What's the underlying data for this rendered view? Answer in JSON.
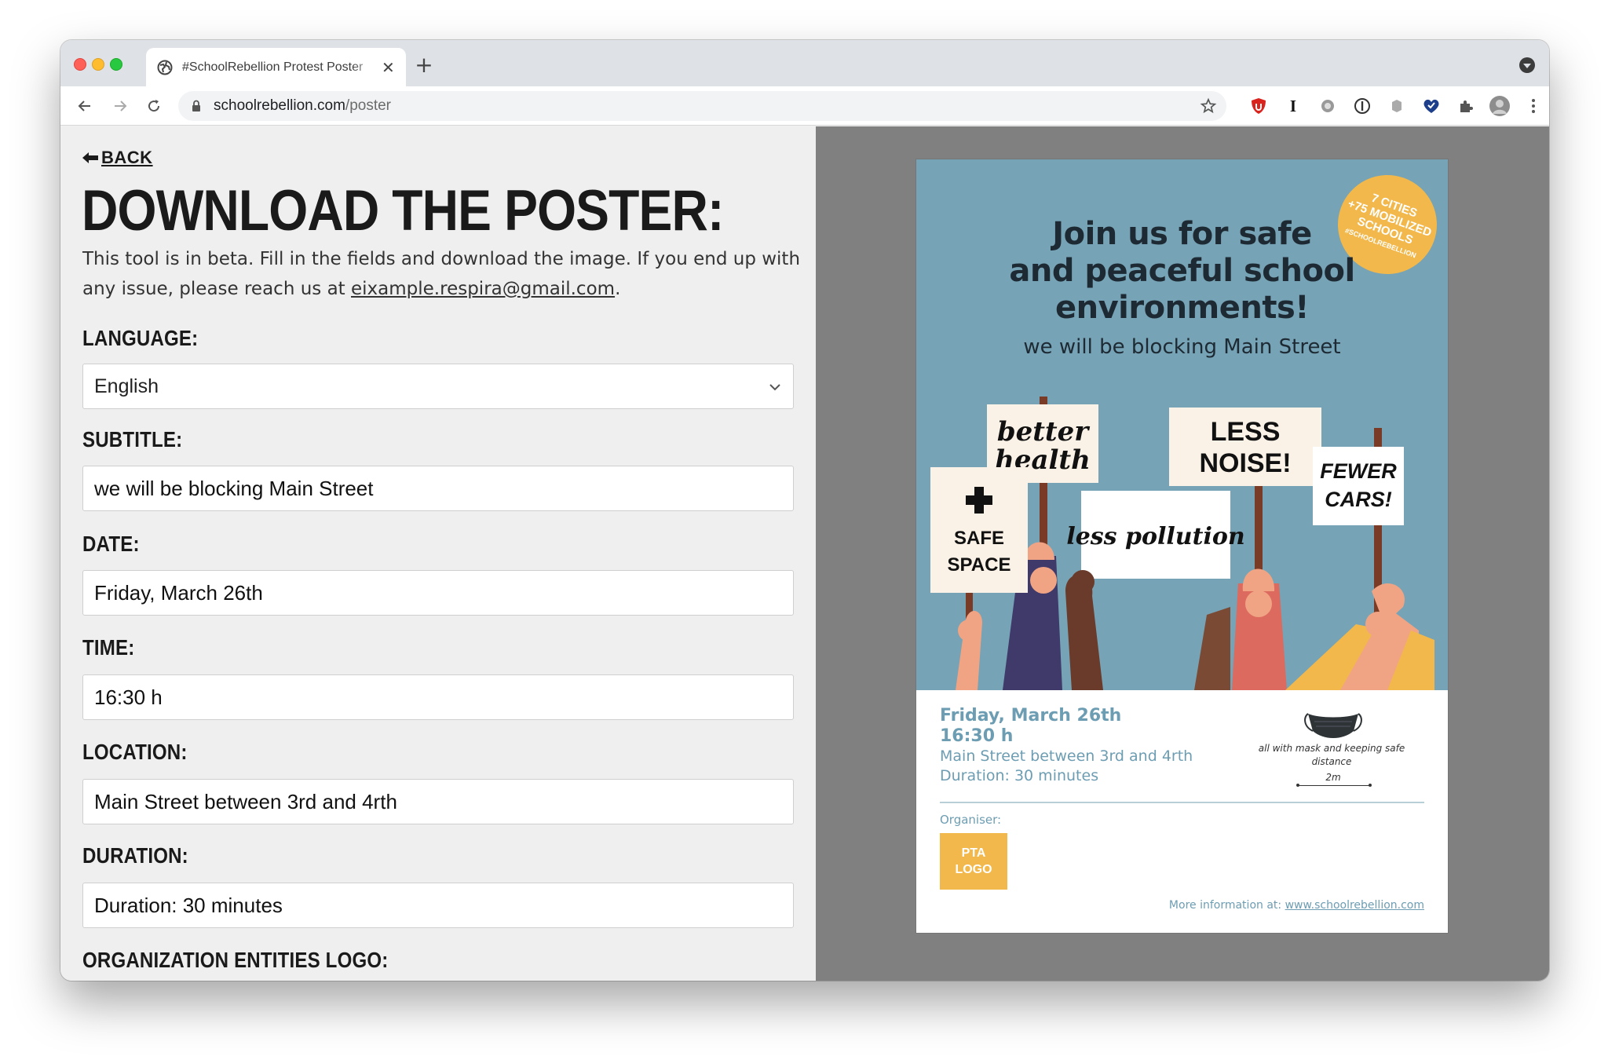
{
  "browser": {
    "tab_title": "#SchoolRebellion Protest Poster",
    "url_domain": "schoolrebellion.com",
    "url_path": "/poster"
  },
  "form": {
    "back_label": "BACK",
    "title": "DOWNLOAD THE POSTER:",
    "intro_text": "This tool is in beta. Fill in the fields and download the image. If you end up with any issue, please reach us at ",
    "intro_email": "eixample.respira@gmail.com",
    "intro_end": ".",
    "language": {
      "label": "LANGUAGE:",
      "value": "English"
    },
    "subtitle": {
      "label": "SUBTITLE:",
      "value": "we will be blocking Main Street"
    },
    "date": {
      "label": "DATE:",
      "value": "Friday, March 26th"
    },
    "time": {
      "label": "TIME:",
      "value": "16:30 h"
    },
    "location": {
      "label": "LOCATION:",
      "value": "Main Street between 3rd and 4rth"
    },
    "duration": {
      "label": "DURATION:",
      "value": "Duration: 30 minutes"
    },
    "logo": {
      "label": "ORGANIZATION ENTITIES LOGO:"
    }
  },
  "poster": {
    "badge_line1": "7 CITIES",
    "badge_line2": "+75 MOBILIZED",
    "badge_line3": "SCHOOLS",
    "badge_line4": "#SCHOOLREBELLION",
    "headline_1": "Join us for safe",
    "headline_2": "and peaceful school",
    "headline_3": "environments!",
    "subtitle": "we will be blocking Main Street",
    "signs": {
      "better_1": "better",
      "better_2": "health",
      "less_1": "LESS",
      "less_2": "NOISE!",
      "fewer_1": "FEWER",
      "fewer_2": "CARS!",
      "safe_1": "SAFE",
      "safe_2": "SPACE",
      "pollution": "less pollution"
    },
    "date": "Friday, March 26th",
    "time": "16:30 h",
    "location": "Main Street between 3rd and 4rth",
    "duration": "Duration: 30 minutes",
    "mask_text": "all with mask and keeping safe distance",
    "mask_distance": "2m",
    "organiser_label": "Organiser:",
    "pta_line1": "PTA",
    "pta_line2": "LOGO",
    "more_info": "More information at: ",
    "more_link": "www.schoolrebellion.com"
  },
  "colors": {
    "poster_blue": "#76a3b5",
    "accent_yellow": "#f2b84b",
    "info_text": "#6d9db2"
  }
}
